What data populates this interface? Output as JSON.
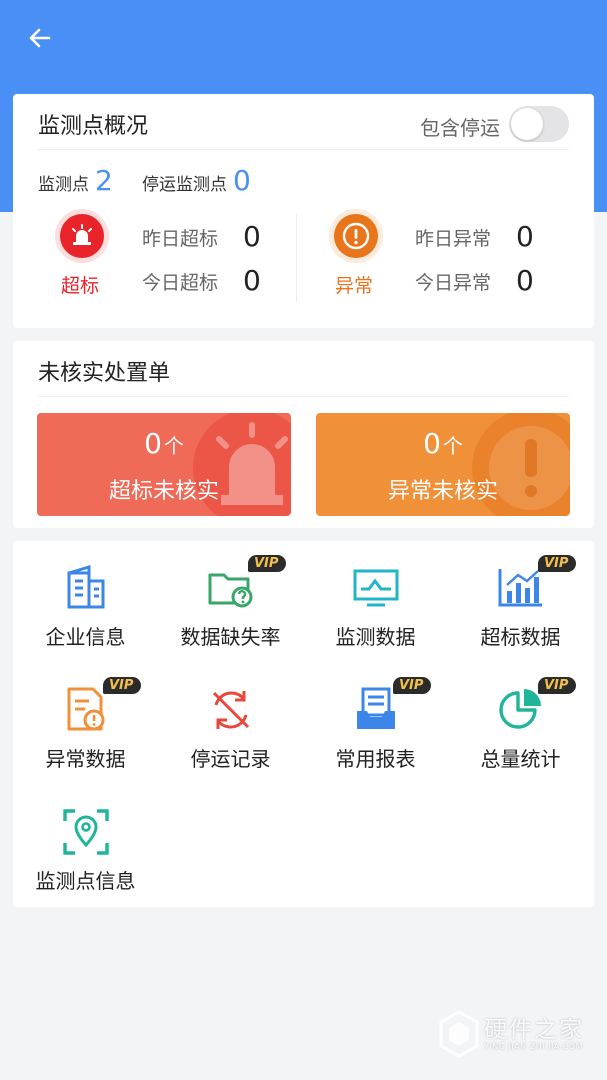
{
  "header": {
    "back_icon": "back-arrow-icon"
  },
  "overview": {
    "title": "监测点概况",
    "toggle_label": "包含停运",
    "toggle_on": false,
    "points_label": "监测点",
    "points_count": "2",
    "stopped_label": "停运监测点",
    "stopped_count": "0",
    "over": {
      "label": "超标",
      "icon": "siren-icon",
      "color": "#e8232a",
      "yesterday_label": "昨日超标",
      "yesterday_value": "0",
      "today_label": "今日超标",
      "today_value": "0"
    },
    "abnormal": {
      "label": "异常",
      "icon": "exclamation-icon",
      "color": "#e8741c",
      "yesterday_label": "昨日异常",
      "yesterday_value": "0",
      "today_label": "今日异常",
      "today_value": "0"
    }
  },
  "unverified": {
    "title": "未核实处置单",
    "over": {
      "count": "0",
      "unit": "个",
      "label": "超标未核实",
      "color": "#f06a58"
    },
    "abnormal": {
      "count": "0",
      "unit": "个",
      "label": "异常未核实",
      "color": "#f0913a"
    }
  },
  "menu": {
    "vip_text": "VIP",
    "items": [
      {
        "label": "企业信息",
        "icon": "building-icon",
        "vip": false
      },
      {
        "label": "数据缺失率",
        "icon": "folder-question-icon",
        "vip": true
      },
      {
        "label": "监测数据",
        "icon": "monitor-icon",
        "vip": false
      },
      {
        "label": "超标数据",
        "icon": "bar-chart-icon",
        "vip": true
      },
      {
        "label": "异常数据",
        "icon": "document-alert-icon",
        "vip": true
      },
      {
        "label": "停运记录",
        "icon": "stop-sync-icon",
        "vip": false
      },
      {
        "label": "常用报表",
        "icon": "report-tray-icon",
        "vip": true
      },
      {
        "label": "总量统计",
        "icon": "pie-chart-icon",
        "vip": true
      },
      {
        "label": "监测点信息",
        "icon": "location-scan-icon",
        "vip": false
      }
    ]
  },
  "watermark": {
    "title": "硬件之家",
    "subtitle": "YING JIAN ZHI JIA.COM"
  }
}
